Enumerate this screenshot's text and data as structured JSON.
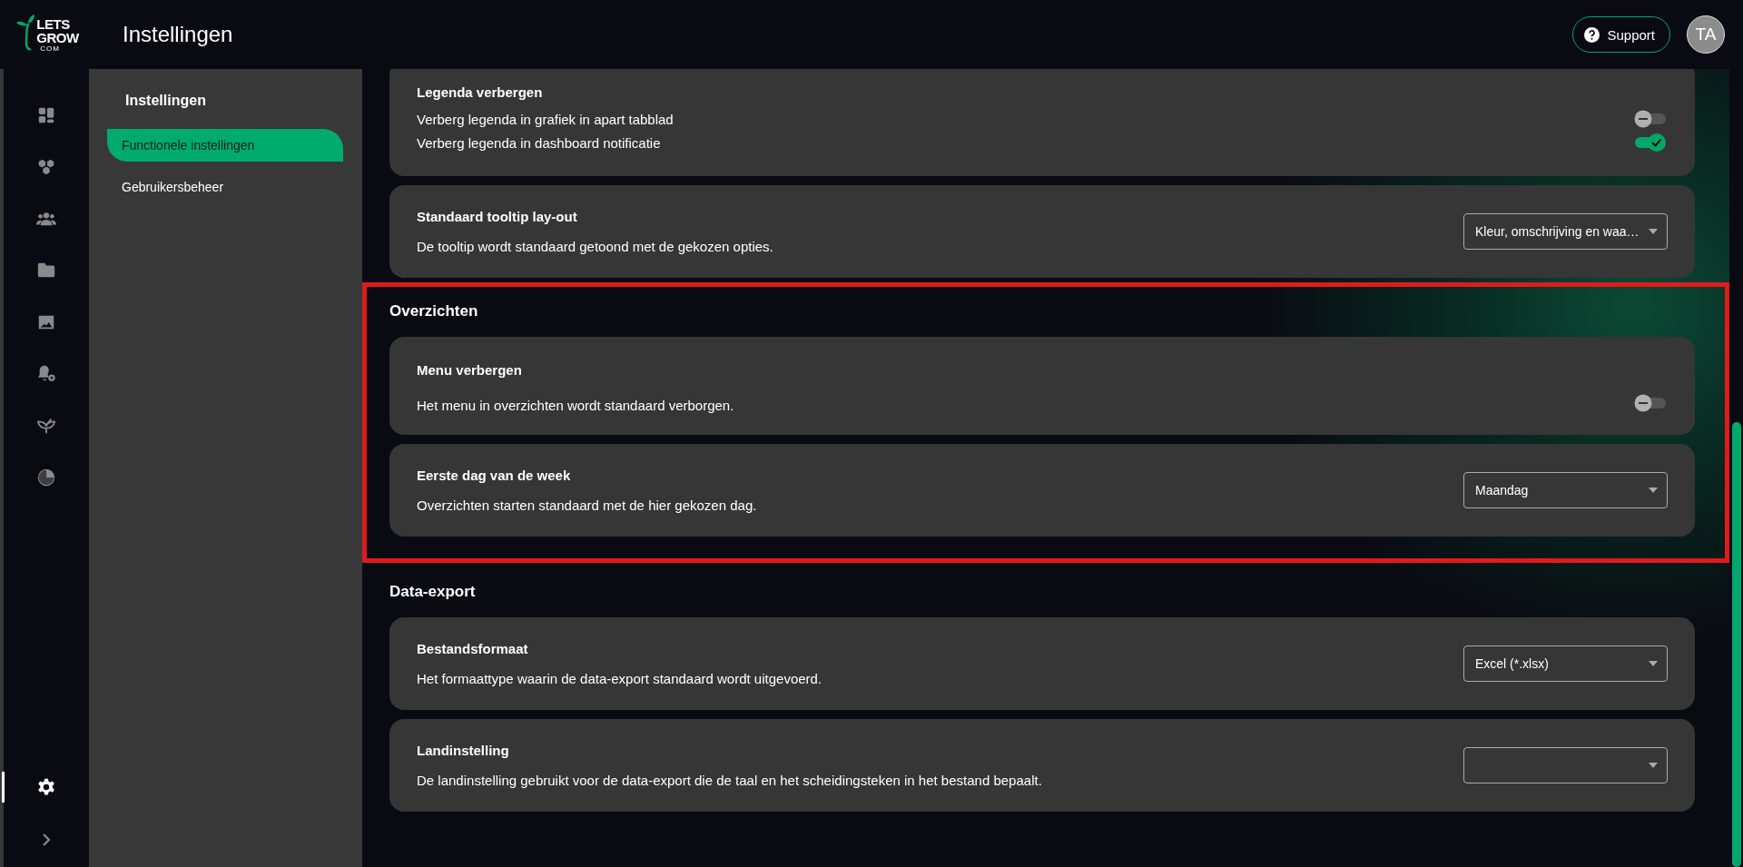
{
  "logo_text": [
    "LETS",
    "GROW",
    "COM"
  ],
  "header": {
    "title": "Instellingen",
    "support": "Support",
    "avatar": "TA"
  },
  "rail": {
    "items": [
      {
        "selected": false
      },
      {
        "selected": false
      },
      {
        "selected": false
      },
      {
        "selected": false
      },
      {
        "selected": false
      },
      {
        "selected": false
      },
      {
        "selected": false
      },
      {
        "selected": false
      },
      {
        "selected": true
      }
    ]
  },
  "subnav": {
    "title": "Instellingen",
    "items": [
      {
        "label": "Functionele instellingen",
        "selected": true
      },
      {
        "label": "Gebruikersbeheer",
        "selected": false
      }
    ]
  },
  "groups": [
    {
      "highlighted": false,
      "cards": [
        {
          "kind": "toggles",
          "title": "Legenda verbergen",
          "options": [
            {
              "label": "Verberg legenda in grafiek in apart tabblad",
              "on": false
            },
            {
              "label": "Verberg legenda in dashboard notificatie",
              "on": true
            }
          ]
        },
        {
          "kind": "select",
          "title": "Standaard tooltip lay-out",
          "description": "De tooltip wordt standaard getoond met de gekozen opties.",
          "value": "Kleur, omschrijving en waa…"
        }
      ]
    },
    {
      "heading": "Overzichten",
      "highlighted": true,
      "cards": [
        {
          "kind": "toggle",
          "title": "Menu verbergen",
          "description": "Het menu in overzichten wordt standaard verborgen.",
          "on": false
        },
        {
          "kind": "select",
          "title": "Eerste dag van de week",
          "description": "Overzichten starten standaard met de hier gekozen dag.",
          "value": "Maandag"
        }
      ]
    },
    {
      "heading": "Data-export",
      "highlighted": false,
      "cards": [
        {
          "kind": "select",
          "title": "Bestandsformaat",
          "description": "Het formaattype waarin de data-export standaard wordt uitgevoerd.",
          "value": "Excel (*.xlsx)"
        },
        {
          "kind": "select",
          "title": "Landinstelling",
          "description": "De landinstelling gebruikt voor de data-export die de taal en het scheidingsteken in het bestand bepaalt."
        }
      ]
    }
  ]
}
